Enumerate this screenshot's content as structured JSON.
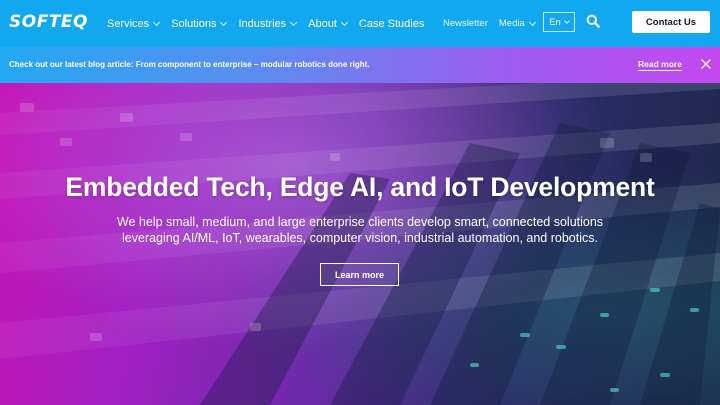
{
  "header": {
    "logo": "SOFTEQ",
    "nav": [
      {
        "label": "Services",
        "dropdown": true
      },
      {
        "label": "Solutions",
        "dropdown": true
      },
      {
        "label": "Industries",
        "dropdown": true
      },
      {
        "label": "About",
        "dropdown": true
      },
      {
        "label": "Case Studies",
        "dropdown": false
      }
    ],
    "newsletter": "Newsletter",
    "media": "Media",
    "language": "En",
    "contact_label": "Contact Us",
    "colors": {
      "header_bg": "#12a8f0",
      "button_bg": "#ffffff"
    }
  },
  "banner": {
    "text": "Check out our latest blog article: From component to enterprise – modular robotics done right.",
    "link": "Read more"
  },
  "hero": {
    "title": "Embedded Tech, Edge AI, and IoT Development",
    "subtitle": "We help small, medium, and large enterprise clients develop smart, connected solutions leveraging AI/ML, IoT, wearables, computer vision, industrial automation, and robotics.",
    "cta": "Learn more"
  },
  "icons": [
    "chevron-down-icon",
    "search-icon",
    "close-icon"
  ]
}
